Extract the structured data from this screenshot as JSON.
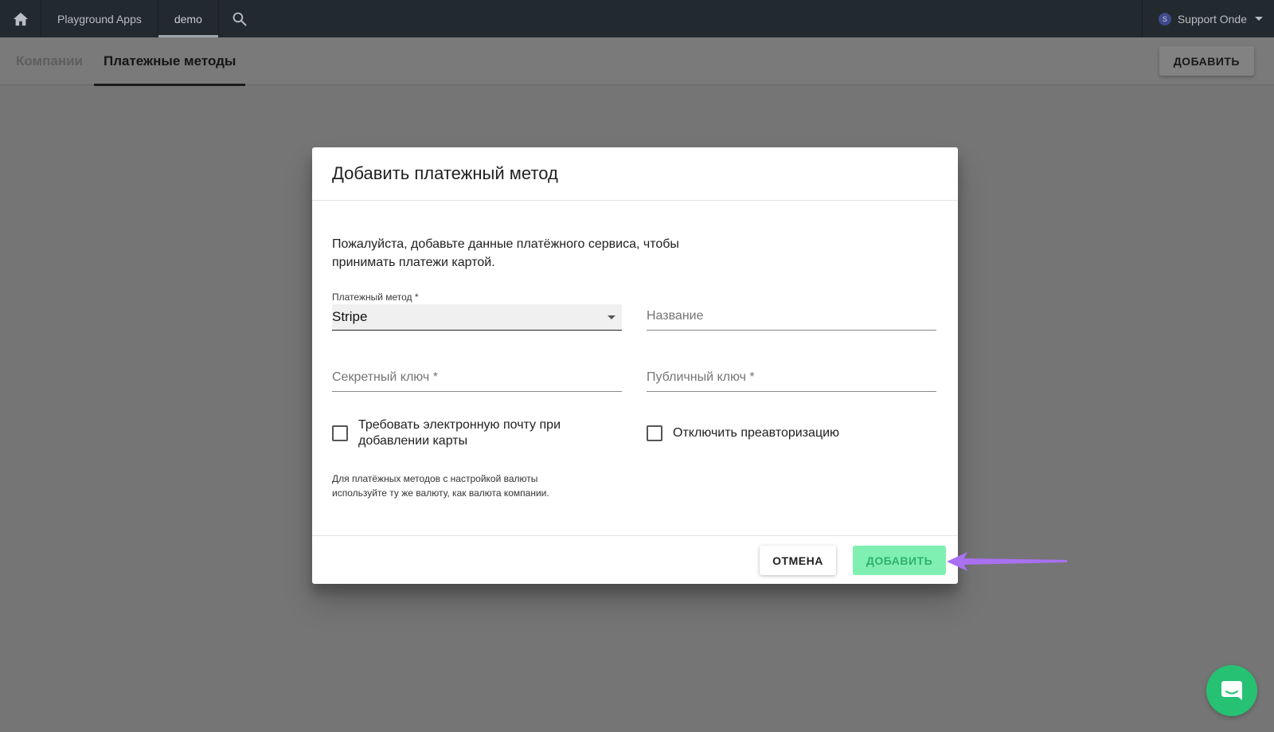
{
  "topbar": {
    "home_icon": "home-icon",
    "apps_label": "Playground Apps",
    "org_label": "demo",
    "search_icon": "search-icon",
    "user_initial": "S",
    "user_name": "Support Onde"
  },
  "subbar": {
    "tabs": [
      {
        "label": "Компании",
        "active": false
      },
      {
        "label": "Платежные методы",
        "active": true
      }
    ],
    "add_button": "ДОБАВИТЬ"
  },
  "dialog": {
    "title": "Добавить платежный метод",
    "description": "Пожалуйста, добавьте данные платёжного сервиса, чтобы принимать платежи картой.",
    "payment_method": {
      "label": "Платежный метод *",
      "value": "Stripe"
    },
    "name_field": {
      "placeholder": "Название",
      "value": ""
    },
    "secret_key_field": {
      "placeholder": "Секретный ключ *",
      "value": ""
    },
    "public_key_field": {
      "placeholder": "Публичный ключ *",
      "value": ""
    },
    "require_email_checkbox": {
      "label": "Требовать электронную почту при добавлении карты",
      "checked": false
    },
    "disable_preauth_checkbox": {
      "label": "Отключить преавторизацию",
      "checked": false
    },
    "hint": "Для платёжных методов с настройкой валюты используйте ту же валюту, как валюта компании.",
    "cancel_button": "ОТМЕНА",
    "add_button": "ДОБАВИТЬ"
  },
  "annotation": {
    "arrow_color": "#a970f0"
  },
  "colors": {
    "topbar": "#222a2f",
    "accent_green": "#26c173",
    "add_button_bg": "#7ff0b1",
    "add_button_text": "#2fb06d"
  },
  "chat": {
    "icon": "chat-bubble-icon"
  }
}
